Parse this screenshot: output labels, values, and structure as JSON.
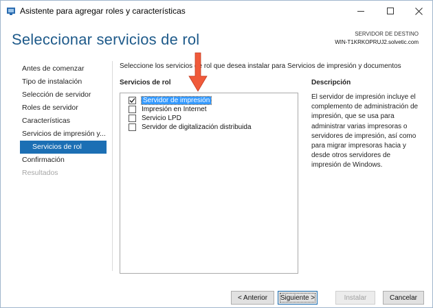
{
  "window": {
    "title": "Asistente para agregar roles y características"
  },
  "header": {
    "page_title": "Seleccionar servicios de rol",
    "dest_label": "SERVIDOR DE DESTINO",
    "dest_server": "WIN-T1KRKOPRUJ2.solvetic.com"
  },
  "nav": {
    "items": [
      {
        "label": "Antes de comenzar"
      },
      {
        "label": "Tipo de instalación"
      },
      {
        "label": "Selección de servidor"
      },
      {
        "label": "Roles de servidor"
      },
      {
        "label": "Características"
      },
      {
        "label": "Servicios de impresión y..."
      },
      {
        "label": "Servicios de rol"
      },
      {
        "label": "Confirmación"
      },
      {
        "label": "Resultados"
      }
    ]
  },
  "content": {
    "instruction": "Seleccione los servicios de rol que desea instalar para Servicios de impresión y documentos",
    "roles_header": "Servicios de rol",
    "roles": [
      {
        "label": "Servidor de impresión",
        "checked": true
      },
      {
        "label": "Impresión en Internet",
        "checked": false
      },
      {
        "label": "Servicio LPD",
        "checked": false
      },
      {
        "label": "Servidor de digitalización distribuida",
        "checked": false
      }
    ],
    "desc_header": "Descripción",
    "desc_text": "El servidor de impresión incluye el complemento de administración de impresión, que se usa para administrar varias impresoras o servidores de impresión, así como para migrar impresoras hacia y desde otros servidores de impresión de Windows."
  },
  "footer": {
    "prev": "< Anterior",
    "next": "Siguiente >",
    "install": "Instalar",
    "cancel": "Cancelar"
  },
  "colors": {
    "accent": "#1c6fb4",
    "title": "#1e5a8a",
    "arrow": "#f05a3a"
  }
}
